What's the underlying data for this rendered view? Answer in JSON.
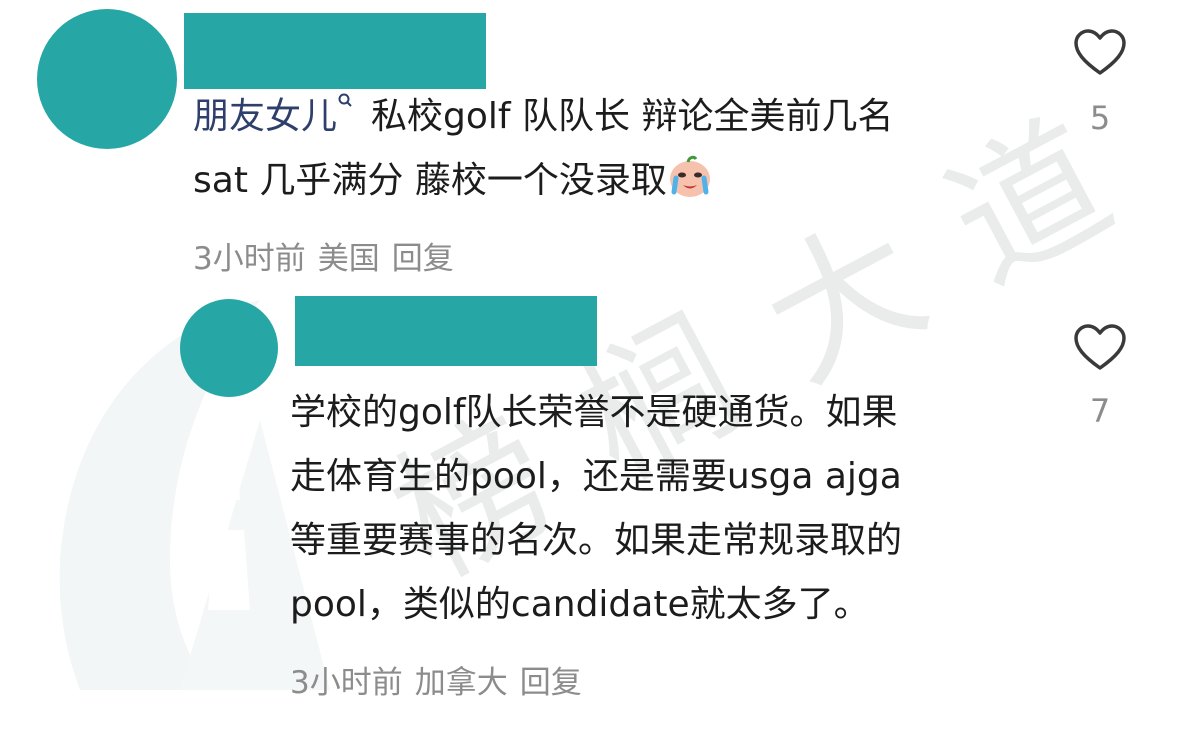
{
  "colors": {
    "avatar": "#26a7a5",
    "name_block": "#26a7a5",
    "mention": "#2e3f6b",
    "text": "#1c1c1c",
    "meta": "#8c8c8c",
    "watermark": "#d7dada"
  },
  "watermark": {
    "text": "榜 榈 大 道"
  },
  "comments": [
    {
      "mention": "朋友女儿",
      "search_icon": "search-icon",
      "lines": [
        "私校golf 队队长 辩论全美前几名",
        "sat 几乎满分 藤校一个没录取"
      ],
      "emoji": "crying-face-emoji",
      "time": "3小时前",
      "location": "美国",
      "reply_label": "回复",
      "likes": "5",
      "like_icon": "heart-outline-icon"
    },
    {
      "lines": [
        "学校的golf队长荣誉不是硬通货。如果",
        "走体育生的pool，还是需要usga ajga",
        "等重要赛事的名次。如果走常规录取的",
        "pool，类似的candidate就太多了。"
      ],
      "time": "3小时前",
      "location": "加拿大",
      "reply_label": "回复",
      "likes": "7",
      "like_icon": "heart-outline-icon"
    }
  ]
}
